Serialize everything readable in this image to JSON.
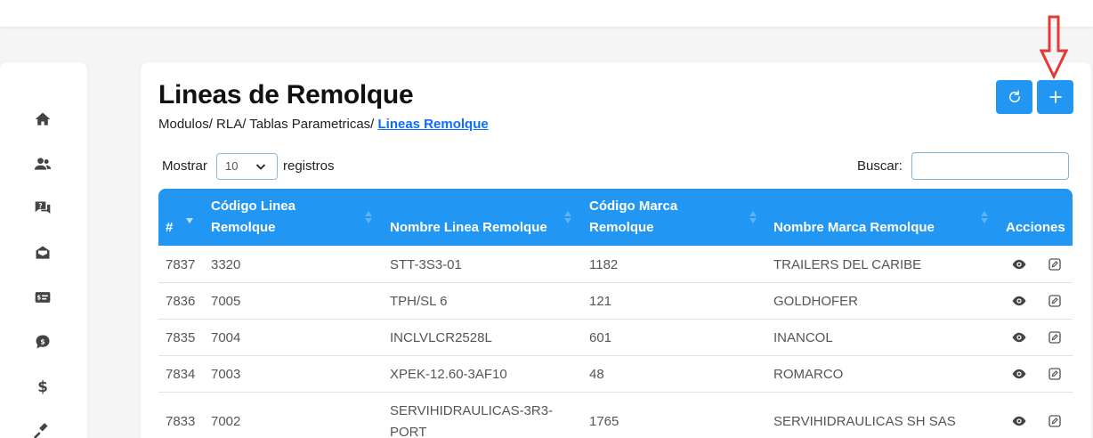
{
  "header": {
    "title": "Lineas de Remolque",
    "breadcrumb_prefix": "Modulos/ RLA/ Tablas Parametricas/ ",
    "breadcrumb_current": "Lineas Remolque"
  },
  "sidebar": {
    "icons": [
      "home-icon",
      "users-icon",
      "chat-question-icon",
      "envelope-open-icon",
      "money-card-icon",
      "money-chat-icon",
      "dollar-icon",
      "gavel-icon"
    ]
  },
  "toolbar": {
    "refresh_icon": "refresh-icon",
    "add_icon": "plus-icon",
    "accent_color": "#2196f3",
    "annotation_arrow_color": "#e53935"
  },
  "table_controls": {
    "length_label": "Mostrar",
    "length_value": "10",
    "length_suffix": "registros",
    "search_label": "Buscar:",
    "search_value": ""
  },
  "table": {
    "columns": [
      {
        "line1": "#",
        "line2": ""
      },
      {
        "line1": "Código Linea",
        "line2": "Remolque"
      },
      {
        "line1": "",
        "line2": "Nombre Linea Remolque"
      },
      {
        "line1": "Código Marca",
        "line2": "Remolque"
      },
      {
        "line1": "",
        "line2": "Nombre Marca Remolque"
      },
      {
        "line1": "",
        "line2": "Acciones"
      }
    ],
    "rows": [
      {
        "id": "7837",
        "codigo_linea": "3320",
        "nombre_linea": "STT-3S3-01",
        "codigo_marca": "1182",
        "nombre_marca": "TRAILERS DEL CARIBE"
      },
      {
        "id": "7836",
        "codigo_linea": "7005",
        "nombre_linea": "TPH/SL 6",
        "codigo_marca": "121",
        "nombre_marca": "GOLDHOFER"
      },
      {
        "id": "7835",
        "codigo_linea": "7004",
        "nombre_linea": "INCLVLCR2528L",
        "codigo_marca": "601",
        "nombre_marca": "INANCOL"
      },
      {
        "id": "7834",
        "codigo_linea": "7003",
        "nombre_linea": "XPEK-12.60-3AF10",
        "codigo_marca": "48",
        "nombre_marca": "ROMARCO"
      },
      {
        "id": "7833",
        "codigo_linea": "7002",
        "nombre_linea": "SERVIHIDRAULICAS-3R3-",
        "nombre_linea_2": "PORT",
        "codigo_marca": "1765",
        "nombre_marca": "SERVIHIDRAULICAS SH SAS"
      }
    ]
  }
}
